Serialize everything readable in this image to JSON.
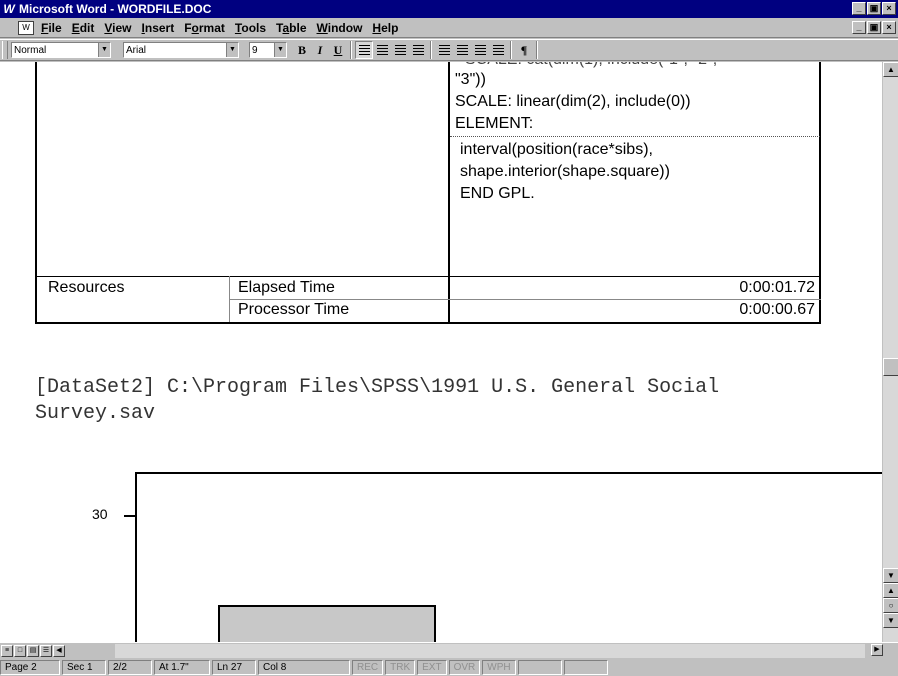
{
  "window": {
    "title": "Microsoft Word - WORDFILE.DOC",
    "app_icon": "W",
    "min": "_",
    "max": "ĸ",
    "close": "×"
  },
  "menu": [
    {
      "pre": "",
      "u": "F",
      "post": "ile"
    },
    {
      "pre": "",
      "u": "E",
      "post": "dit"
    },
    {
      "pre": "",
      "u": "V",
      "post": "iew"
    },
    {
      "pre": "",
      "u": "I",
      "post": "nsert"
    },
    {
      "pre": "F",
      "u": "o",
      "post": "rmat"
    },
    {
      "pre": "",
      "u": "T",
      "post": "ools"
    },
    {
      "pre": "T",
      "u": "a",
      "post": "ble"
    },
    {
      "pre": "",
      "u": "W",
      "post": "indow"
    },
    {
      "pre": "",
      "u": "H",
      "post": "elp"
    }
  ],
  "toolbar": {
    "style": "Normal",
    "font": "Arial",
    "size": "9",
    "bold": "B",
    "italic": "I",
    "underline": "U",
    "pilcrow": "¶"
  },
  "table": {
    "code_lines_top": [
      "\"3\"))",
      " SCALE: linear(dim(2), include(0))",
      " ELEMENT:"
    ],
    "code_lines_bottom": [
      "interval(position(race*sibs),",
      "shape.interior(shape.square))",
      "END GPL."
    ],
    "resources_label": "Resources",
    "rows": [
      {
        "label": "Elapsed Time",
        "value": "0:00:01.72"
      },
      {
        "label": "Processor Time",
        "value": "0:00:00.67"
      }
    ]
  },
  "dataset_line1": "[DataSet2] C:\\Program Files\\SPSS\\1991 U.S. General Social",
  "dataset_line2": "Survey.sav",
  "chart_data": {
    "type": "bar",
    "y_ticks": [
      "30"
    ],
    "title": "",
    "xlabel": "",
    "ylabel": ""
  },
  "status": {
    "page": "Page 2",
    "sec": "Sec 1",
    "pages": "2/2",
    "at": "At 1.7\"",
    "ln": "Ln 27",
    "col": "Col 8",
    "rec": "REC",
    "trk": "TRK",
    "ext": "EXT",
    "ovr": "OVR",
    "wph": "WPH"
  }
}
